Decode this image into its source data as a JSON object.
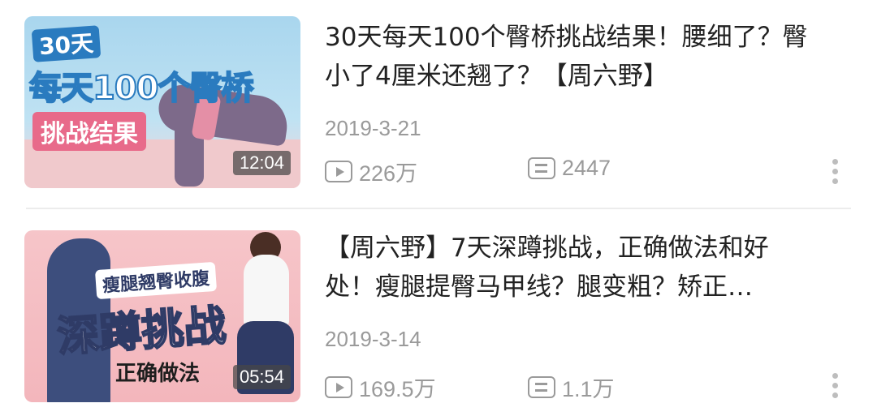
{
  "videos": [
    {
      "title": "30天每天100个臀桥挑战结果！腰细了？臀小了4厘米还翘了？【周六野】",
      "date": "2019-3-21",
      "views": "226万",
      "comments": "2447",
      "duration": "12:04",
      "thumbnail": {
        "tag": "30天",
        "headline": "每天100个臀桥",
        "subtitle": "挑战结果"
      }
    },
    {
      "title": "【周六野】7天深蹲挑战，正确做法和好处！瘦腿提臀马甲线？腿变粗？矫正…",
      "date": "2019-3-14",
      "views": "169.5万",
      "comments": "1.1万",
      "duration": "05:54",
      "thumbnail": {
        "tag": "瘦腿翘臀收腹",
        "headline": "深蹲挑战",
        "subtitle": "正确做法"
      }
    }
  ],
  "icons": {
    "views": "play-icon",
    "comments": "comment-icon",
    "more": "more-vertical-icon"
  },
  "colors": {
    "meta_text": "#9a9a9a",
    "title_text": "#222222"
  }
}
